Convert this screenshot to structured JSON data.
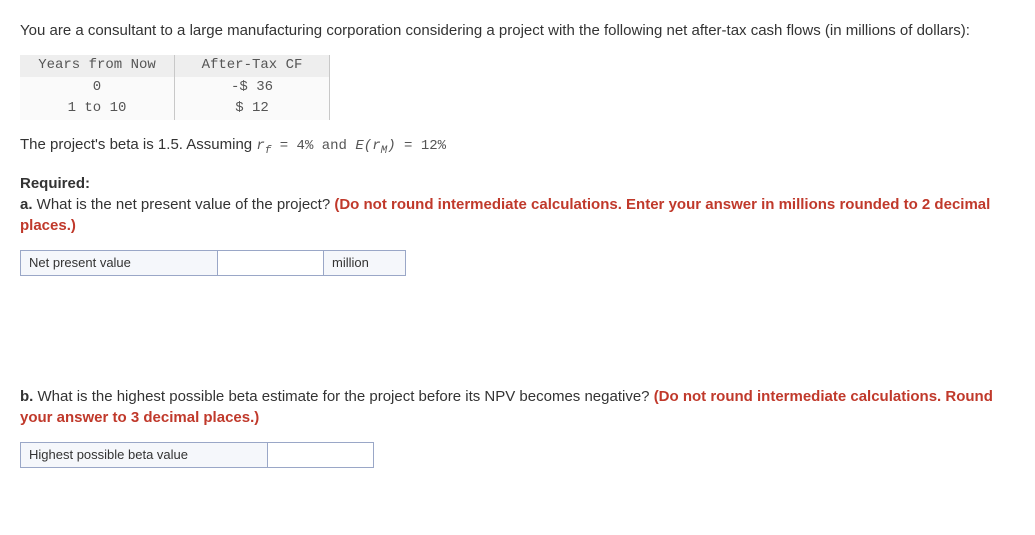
{
  "intro": "You are a consultant to a large manufacturing corporation considering a project with the following net after-tax cash flows (in millions of dollars):",
  "table": {
    "headers": [
      "Years from Now",
      "After-Tax CF"
    ],
    "rows": [
      {
        "c0": "0",
        "c1": "-$ 36"
      },
      {
        "c0": "1 to 10",
        "c1": "$ 12"
      }
    ]
  },
  "assumption": {
    "pre": "The project's beta is 1.5. Assuming ",
    "rf_sym": "r",
    "rf_sub": "f",
    "rf_eq": " = 4% and ",
    "erm_open": "E(",
    "erm_r": "r",
    "erm_m": "M",
    "erm_close": ")",
    "erm_eq": " = 12%"
  },
  "required_label": "Required:",
  "part_a": {
    "label": "a.",
    "q": " What is the net present value of the project? ",
    "hint": "(Do not round intermediate calculations. Enter your answer in millions rounded to 2 decimal places.)"
  },
  "answer_a": {
    "label": "Net present value",
    "unit": "million"
  },
  "part_b": {
    "label": "b.",
    "q": " What is the highest possible beta estimate for the project before its NPV becomes negative? ",
    "hint": "(Do not round intermediate calculations. Round your answer to 3 decimal places.)"
  },
  "answer_b": {
    "label": "Highest possible beta value"
  }
}
